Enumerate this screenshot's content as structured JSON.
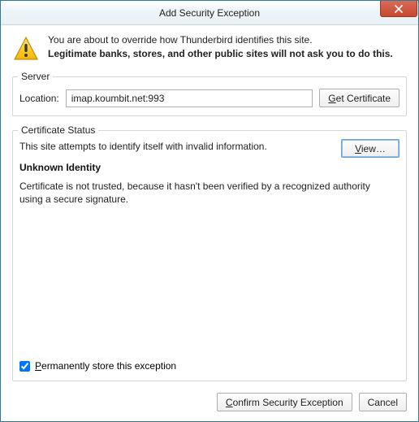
{
  "window": {
    "title": "Add Security Exception"
  },
  "warning": {
    "line1": "You are about to override how Thunderbird identifies this site.",
    "line2": "Legitimate banks, stores, and other public sites will not ask you to do this."
  },
  "server": {
    "legend": "Server",
    "location_label": "Location:",
    "location_value": "imap.koumbit.net:993",
    "get_cert_prefix": "G",
    "get_cert_rest": "et Certificate"
  },
  "cert": {
    "legend": "Certificate Status",
    "status_line": "This site attempts to identify itself with invalid information.",
    "view_prefix": "V",
    "view_rest": "iew…",
    "heading": "Unknown Identity",
    "description": "Certificate is not trusted, because it hasn't been verified by a recognized authority using a secure signature."
  },
  "permanent": {
    "checked": true,
    "label_prefix": "P",
    "label_rest": "ermanently store this exception"
  },
  "buttons": {
    "confirm_prefix": "C",
    "confirm_rest": "onfirm Security Exception",
    "cancel": "Cancel"
  }
}
